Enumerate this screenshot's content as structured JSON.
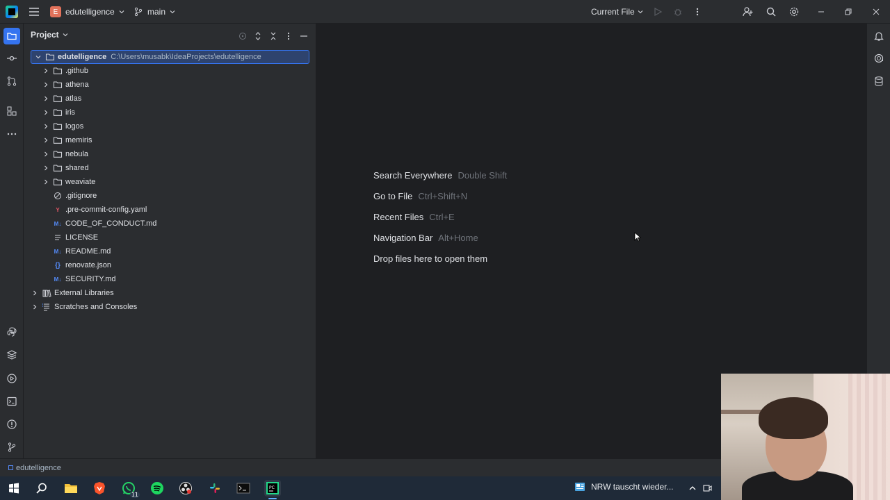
{
  "titlebar": {
    "project_badge": "E",
    "project_name": "edutelligence",
    "branch": "main",
    "run_config": "Current File"
  },
  "project_panel": {
    "title": "Project",
    "root": {
      "name": "edutelligence",
      "path": "C:\\Users\\musabk\\IdeaProjects\\edutelligence"
    },
    "folders": [
      ".github",
      "athena",
      "atlas",
      "iris",
      "logos",
      "memiris",
      "nebula",
      "shared",
      "weaviate"
    ],
    "files": [
      {
        "name": ".gitignore",
        "icon": "ignore-icon"
      },
      {
        "name": ".pre-commit-config.yaml",
        "icon": "yaml-icon"
      },
      {
        "name": "CODE_OF_CONDUCT.md",
        "icon": "markdown-icon"
      },
      {
        "name": "LICENSE",
        "icon": "text-file-icon"
      },
      {
        "name": "README.md",
        "icon": "markdown-icon"
      },
      {
        "name": "renovate.json",
        "icon": "json-icon"
      },
      {
        "name": "SECURITY.md",
        "icon": "markdown-icon"
      }
    ],
    "external_libraries": "External Libraries",
    "scratches": "Scratches and Consoles"
  },
  "editor_hints": [
    {
      "label": "Search Everywhere",
      "shortcut": "Double Shift"
    },
    {
      "label": "Go to File",
      "shortcut": "Ctrl+Shift+N"
    },
    {
      "label": "Recent Files",
      "shortcut": "Ctrl+E"
    },
    {
      "label": "Navigation Bar",
      "shortcut": "Alt+Home"
    },
    {
      "label": "Drop files here to open them",
      "shortcut": ""
    }
  ],
  "statusbar": {
    "breadcrumb": "edutelligence"
  },
  "taskbar": {
    "whatsapp_badge": "11",
    "news_text": "NRW tauscht wieder..."
  },
  "colors": {
    "accent": "#3574f0",
    "panel_bg": "#2b2d30",
    "editor_bg": "#1e1f22",
    "selection_bg": "#2e436e"
  }
}
